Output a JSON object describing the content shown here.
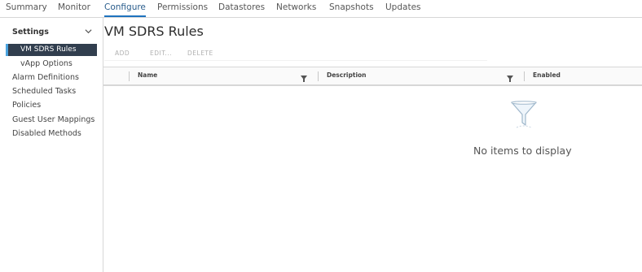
{
  "tabs": [
    {
      "label": "Summary"
    },
    {
      "label": "Monitor"
    },
    {
      "label": "Configure"
    },
    {
      "label": "Permissions"
    },
    {
      "label": "Datastores"
    },
    {
      "label": "Networks"
    },
    {
      "label": "Snapshots"
    },
    {
      "label": "Updates"
    }
  ],
  "sidebar": {
    "section_label": "Settings",
    "items": [
      {
        "label": "VM SDRS Rules"
      },
      {
        "label": "vApp Options"
      },
      {
        "label": "Alarm Definitions"
      },
      {
        "label": "Scheduled Tasks"
      },
      {
        "label": "Policies"
      },
      {
        "label": "Guest User Mappings"
      },
      {
        "label": "Disabled Methods"
      }
    ]
  },
  "page": {
    "title": "VM SDRS Rules"
  },
  "toolbar": {
    "add_label": "ADD",
    "edit_label": "EDIT...",
    "delete_label": "DELETE"
  },
  "grid": {
    "columns": [
      {
        "label": "Name"
      },
      {
        "label": "Description"
      },
      {
        "label": "Enabled"
      }
    ],
    "empty_message": "No items to display"
  },
  "colors": {
    "accent": "#1e73be",
    "selected_bg": "#313e4e"
  }
}
